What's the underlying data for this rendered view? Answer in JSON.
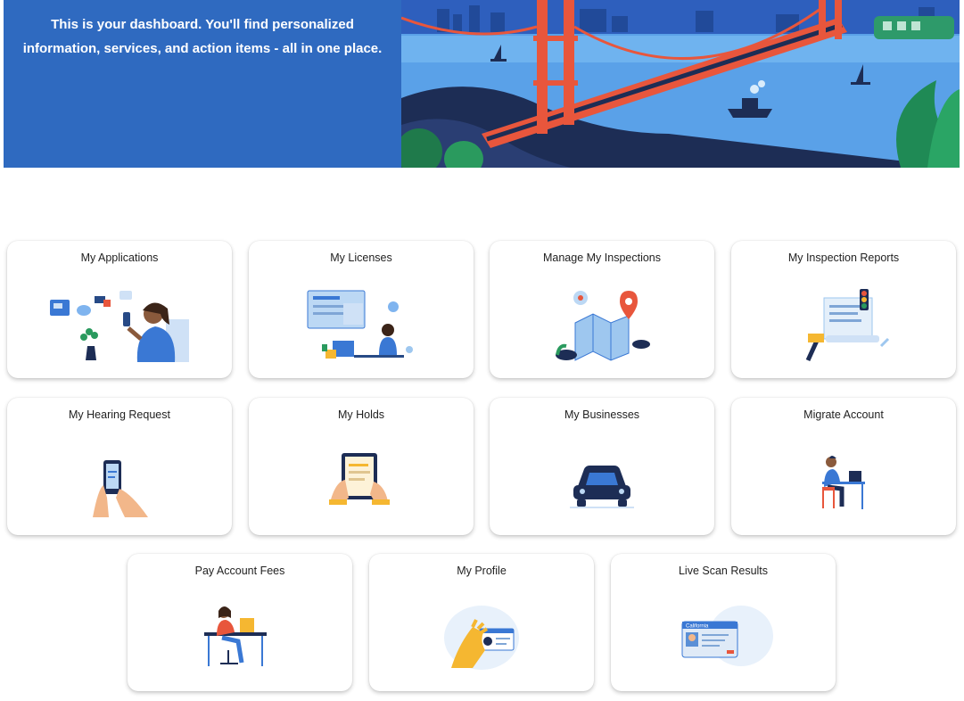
{
  "hero": {
    "message": "This is your dashboard. You'll find personalized information, services, and action items - all in one place."
  },
  "cards": [
    {
      "title": "My Applications",
      "icon": "applications-illustration"
    },
    {
      "title": "My Licenses",
      "icon": "licenses-illustration"
    },
    {
      "title": "Manage My Inspections",
      "icon": "inspections-map-illustration"
    },
    {
      "title": "My Inspection Reports",
      "icon": "inspection-reports-illustration"
    },
    {
      "title": "My Hearing Request",
      "icon": "phone-in-hands-illustration"
    },
    {
      "title": "My Holds",
      "icon": "tablet-in-hands-illustration"
    },
    {
      "title": "My Businesses",
      "icon": "car-illustration"
    },
    {
      "title": "Migrate Account",
      "icon": "person-at-desk-illustration"
    },
    {
      "title": "Pay Account Fees",
      "icon": "person-working-laptop-illustration"
    },
    {
      "title": "My Profile",
      "icon": "hand-holding-id-card-illustration"
    },
    {
      "title": "Live Scan Results",
      "icon": "california-id-card-illustration"
    }
  ],
  "id_card_label": "California",
  "colors": {
    "hero_blue": "#2f6ac0",
    "bridge_red": "#e8563c",
    "accent_yellow": "#f5b731"
  }
}
